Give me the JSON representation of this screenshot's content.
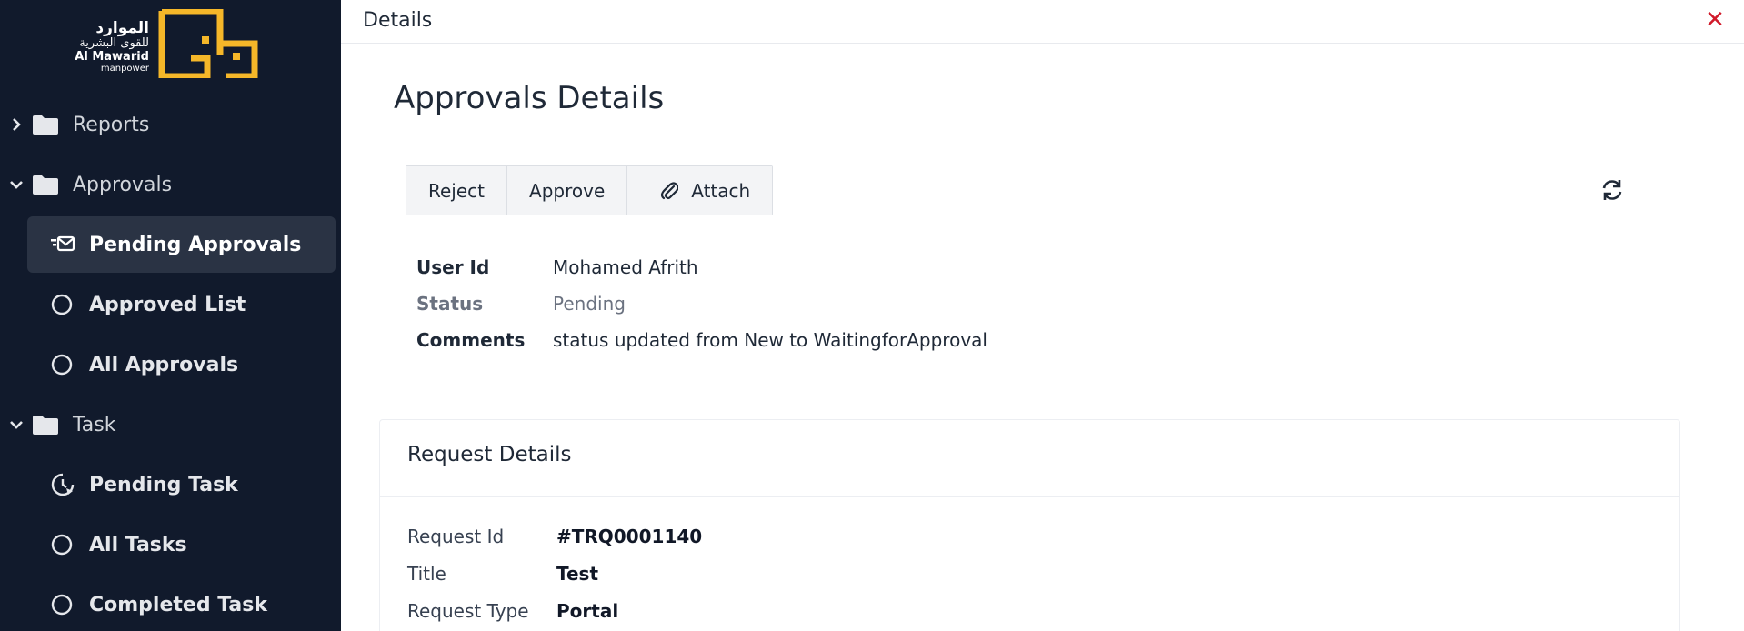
{
  "logo": {
    "arabic_line1": "الموارد",
    "arabic_line2": "للقوى البشرية",
    "english_line1": "Al Mawarid",
    "english_line2": "manpower",
    "accent_color": "#f5b729"
  },
  "sidebar": {
    "items": [
      {
        "type": "folder",
        "label": "Reports",
        "expanded": false,
        "icon": "folder-icon"
      },
      {
        "type": "folder",
        "label": "Approvals",
        "expanded": true,
        "icon": "folder-icon"
      },
      {
        "type": "sub",
        "label": "Pending Approvals",
        "active": true,
        "icon": "pending-mail-icon"
      },
      {
        "type": "sub",
        "label": "Approved List",
        "icon": "circle-icon"
      },
      {
        "type": "sub",
        "label": "All Approvals",
        "icon": "circle-icon"
      },
      {
        "type": "folder",
        "label": "Task",
        "expanded": true,
        "icon": "folder-icon"
      },
      {
        "type": "sub",
        "label": "Pending Task",
        "icon": "clock-icon"
      },
      {
        "type": "sub",
        "label": "All Tasks",
        "icon": "circle-icon"
      },
      {
        "type": "sub",
        "label": "Completed Task",
        "icon": "circle-icon"
      }
    ]
  },
  "topbar": {
    "title": "Details",
    "close_icon": "close-icon",
    "close_color": "#d11a2a"
  },
  "main": {
    "page_title": "Approvals Details",
    "buttons": {
      "reject": "Reject",
      "approve": "Approve",
      "attach": "Attach"
    },
    "refresh_icon": "refresh-icon",
    "info": {
      "user_id_label": "User Id",
      "user_id_value": "Mohamed Afrith",
      "status_label": "Status",
      "status_value": "Pending",
      "comments_label": "Comments",
      "comments_value": "status updated from New to WaitingforApproval"
    },
    "request_card": {
      "title": "Request Details",
      "rows": [
        {
          "label": "Request Id",
          "value": "#TRQ0001140"
        },
        {
          "label": "Title",
          "value": "Test"
        },
        {
          "label": "Request Type",
          "value": "Portal"
        }
      ]
    }
  },
  "colors": {
    "sidebar_bg": "#111a2c",
    "sidebar_active_bg": "#2a3344",
    "logo_gold": "#f5b729"
  }
}
